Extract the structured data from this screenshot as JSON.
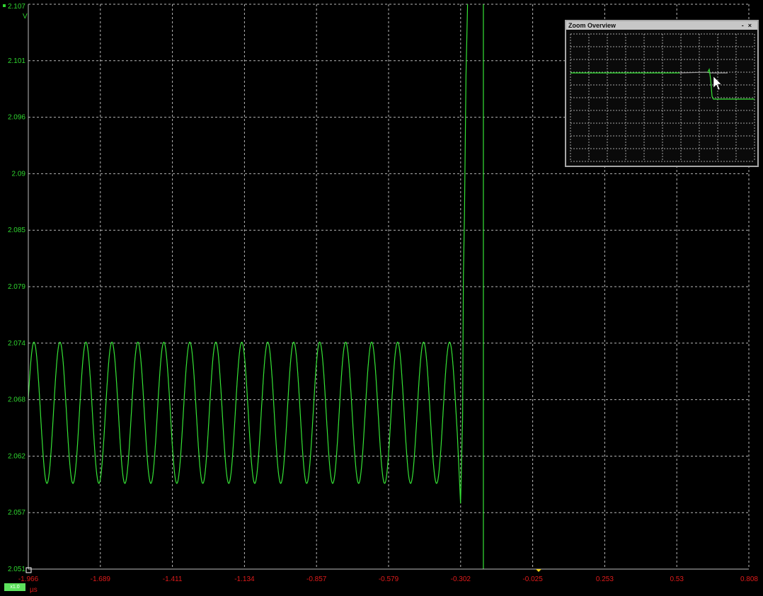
{
  "chart_data": {
    "type": "line",
    "title": "",
    "xlabel": "µs",
    "ylabel": "V",
    "xlim": [
      -1.966,
      0.808
    ],
    "ylim": [
      2.051,
      2.107
    ],
    "x_ticks": [
      "-1.966",
      "-1.689",
      "-1.411",
      "-1.134",
      "-0.857",
      "-0.579",
      "-0.302",
      "-0.025",
      "0.253",
      "0.53",
      "0.808"
    ],
    "y_ticks": [
      "2.051",
      "2.057",
      "2.062",
      "2.068",
      "2.074",
      "2.079",
      "2.085",
      "2.09",
      "2.096",
      "2.101",
      "2.107"
    ],
    "grid": true,
    "series": [
      {
        "color": "#35e335",
        "description_points": {
          "oscillation_start": -1.966,
          "oscillation_end": -0.302,
          "oscillation_period_us": 0.1,
          "oscillation_peak_V": 2.0735,
          "oscillation_trough_V": 2.0595,
          "dip_x": -0.302,
          "dip_V": 2.0575,
          "rise1_x": -0.287,
          "drop_x": -0.214
        }
      }
    ]
  },
  "range_tag": "x1.0",
  "zoom_overview": {
    "title": "Zoom Overview",
    "min_button": "-",
    "close_button": "×"
  }
}
